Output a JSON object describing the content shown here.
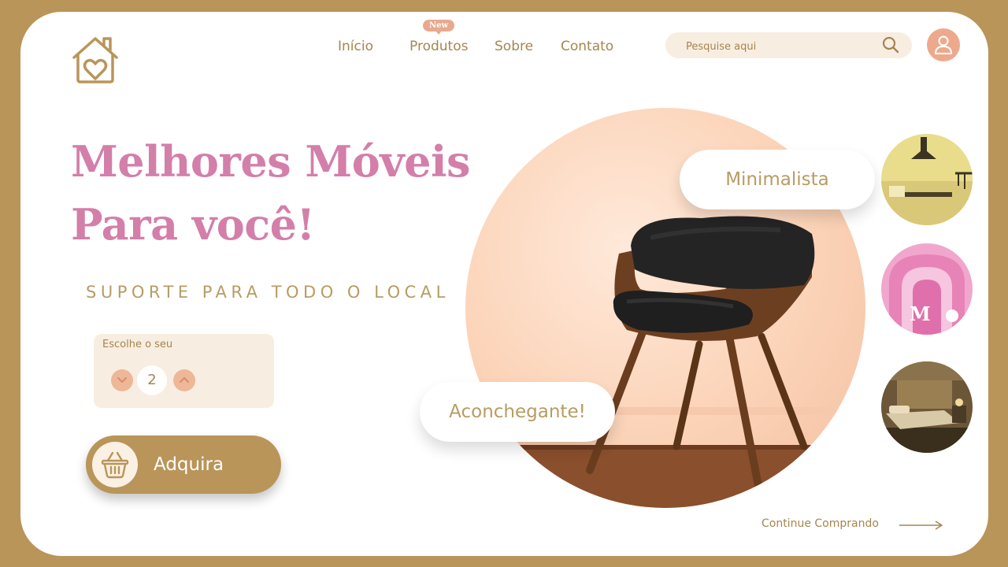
{
  "nav": {
    "items": [
      "Início",
      "Produtos",
      "Sobre",
      "Contato"
    ],
    "new_badge": "New"
  },
  "search": {
    "placeholder": "Pesquise aqui",
    "value": ""
  },
  "hero": {
    "title_line1": "Melhores Móveis",
    "title_line2": "Para você!",
    "subtitle": "SUPORTE PARA TODO O LOCAL"
  },
  "quantity": {
    "label": "Escolhe o seu",
    "value": "2"
  },
  "buy_button": {
    "label": "Adquira"
  },
  "tags": {
    "minimal": "Minimalista",
    "cozy": "Aconchegante!"
  },
  "continue_link": "Continue Comprando",
  "icons": {
    "logo": "house-heart-icon",
    "search": "search-icon",
    "user": "user-icon",
    "down": "chevron-down-icon",
    "up": "chevron-up-icon",
    "basket": "basket-icon",
    "arrow": "arrow-right-icon"
  },
  "colors": {
    "frame": "#b9955a",
    "accent_pink": "#d37fa9",
    "gold_text": "#a5864f",
    "peach": "#eea98d",
    "cream": "#f8ede1"
  }
}
